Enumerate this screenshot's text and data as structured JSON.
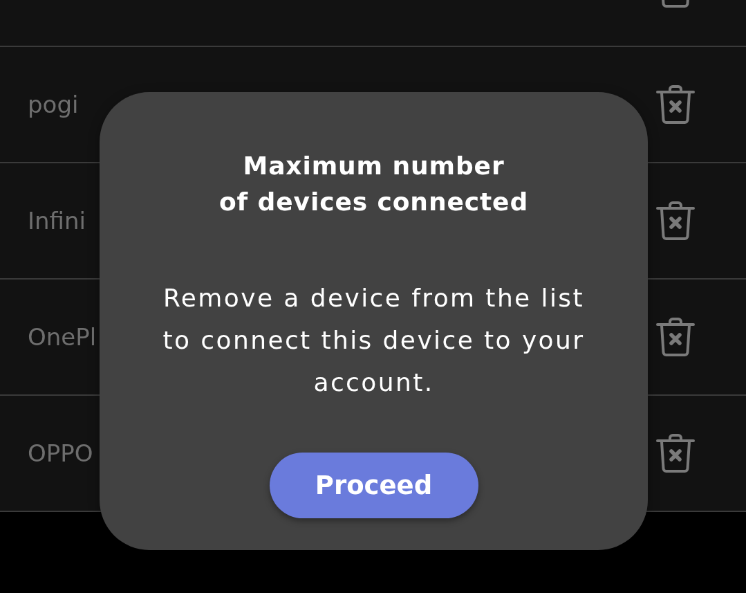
{
  "devices": [
    {
      "cut_off": true
    },
    {
      "name": "pogi",
      "cut_off": false
    },
    {
      "name": "Infini",
      "cut_off": false
    },
    {
      "name": "OnePl",
      "cut_off": false
    },
    {
      "name": "OPPO",
      "cut_off": false
    }
  ],
  "dialog": {
    "title": "Maximum number\nof devices connected",
    "message": "Remove a device from the list\nto connect this device to your\naccount.",
    "button": "Proceed"
  }
}
